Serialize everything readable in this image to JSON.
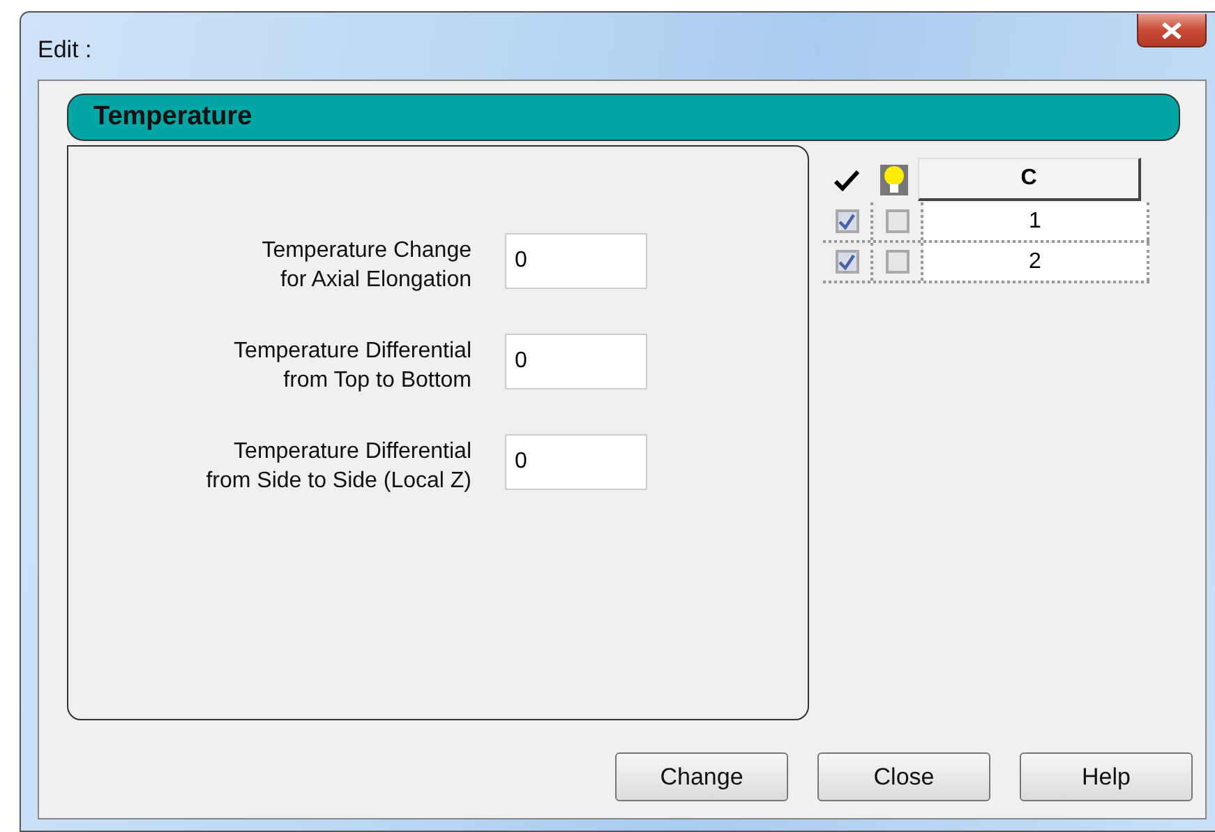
{
  "window": {
    "title": "Edit :"
  },
  "section": {
    "title": "Temperature"
  },
  "fields": [
    {
      "label": "Temperature Change\nfor Axial Elongation",
      "value": "0"
    },
    {
      "label": "Temperature Differential\nfrom Top to Bottom",
      "value": "0"
    },
    {
      "label": "Temperature Differential\nfrom Side to Side (Local Z)",
      "value": "0"
    }
  ],
  "table": {
    "columns": [
      "C"
    ],
    "rows": [
      {
        "enabled": true,
        "highlighted": false,
        "cells": [
          "1"
        ]
      },
      {
        "enabled": true,
        "highlighted": false,
        "cells": [
          "2"
        ]
      }
    ]
  },
  "buttons": [
    "Change",
    "Close",
    "Help"
  ]
}
